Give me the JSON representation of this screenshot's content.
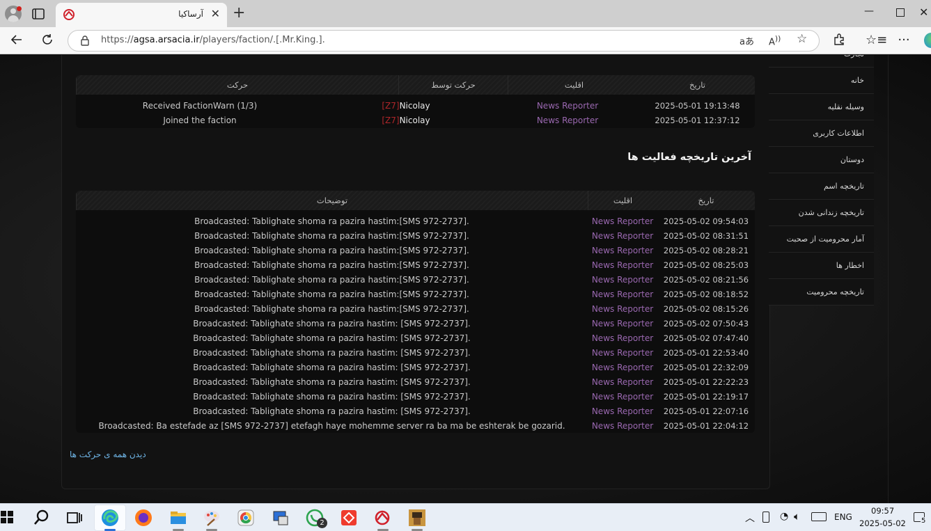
{
  "browser": {
    "tab_title": "آرساکیا",
    "url_prefix": "https://",
    "url_host": "agsa.arsacia.ir",
    "url_path": "/players/faction/.[.Mr.King.]."
  },
  "sidebar": {
    "items": [
      "تجارت",
      "خانه",
      "وسیله نقلیه",
      "اطلاعات کاربری",
      "دوستان",
      "تاریخچه اسم",
      "تاریخچه زندانی شدن",
      "آمار محرومیت از صحبت",
      "اخطار ها",
      "تاریخچه محرومیت"
    ]
  },
  "faction_actions": {
    "headers": {
      "date": "تاریخ",
      "rank": "اقلیت",
      "by": "حرکت توسط",
      "action": "حرکت"
    },
    "rows": [
      {
        "date": "2025-05-01 19:13:48",
        "rank": "News Reporter",
        "by_tag": "[Z7]",
        "by_name": "Nicolay",
        "action": "Received FactionWarn (1/3)"
      },
      {
        "date": "2025-05-01 12:37:12",
        "rank": "News Reporter",
        "by_tag": "[Z7]",
        "by_name": "Nicolay",
        "action": "Joined the faction"
      }
    ]
  },
  "activity": {
    "title": "آخرین تاریخچه فعالیت ها",
    "headers": {
      "date": "تاریخ",
      "rank": "اقلیت",
      "desc": "توضیحات"
    },
    "rows": [
      {
        "date": "2025-05-02 09:54:03",
        "rank": "News Reporter",
        "desc": "Broadcasted: Tablighate shoma ra pazira hastim:[SMS 972-2737]."
      },
      {
        "date": "2025-05-02 08:31:51",
        "rank": "News Reporter",
        "desc": "Broadcasted: Tablighate shoma ra pazira hastim:[SMS 972-2737]."
      },
      {
        "date": "2025-05-02 08:28:21",
        "rank": "News Reporter",
        "desc": "Broadcasted: Tablighate shoma ra pazira hastim:[SMS 972-2737]."
      },
      {
        "date": "2025-05-02 08:25:03",
        "rank": "News Reporter",
        "desc": "Broadcasted: Tablighate shoma ra pazira hastim:[SMS 972-2737]."
      },
      {
        "date": "2025-05-02 08:21:56",
        "rank": "News Reporter",
        "desc": "Broadcasted: Tablighate shoma ra pazira hastim:[SMS 972-2737]."
      },
      {
        "date": "2025-05-02 08:18:52",
        "rank": "News Reporter",
        "desc": "Broadcasted: Tablighate shoma ra pazira hastim:[SMS 972-2737]."
      },
      {
        "date": "2025-05-02 08:15:26",
        "rank": "News Reporter",
        "desc": "Broadcasted: Tablighate shoma ra pazira hastim:[SMS 972-2737]."
      },
      {
        "date": "2025-05-02 07:50:43",
        "rank": "News Reporter",
        "desc": "Broadcasted: Tablighate shoma ra pazira hastim: [SMS 972-2737]."
      },
      {
        "date": "2025-05-02 07:47:40",
        "rank": "News Reporter",
        "desc": "Broadcasted: Tablighate shoma ra pazira hastim: [SMS 972-2737]."
      },
      {
        "date": "2025-05-01 22:53:40",
        "rank": "News Reporter",
        "desc": "Broadcasted: Tablighate shoma ra pazira hastim: [SMS 972-2737]."
      },
      {
        "date": "2025-05-01 22:32:09",
        "rank": "News Reporter",
        "desc": "Broadcasted: Tablighate shoma ra pazira hastim: [SMS 972-2737]."
      },
      {
        "date": "2025-05-01 22:22:23",
        "rank": "News Reporter",
        "desc": "Broadcasted: Tablighate shoma ra pazira hastim: [SMS 972-2737]."
      },
      {
        "date": "2025-05-01 22:19:17",
        "rank": "News Reporter",
        "desc": "Broadcasted: Tablighate shoma ra pazira hastim: [SMS 972-2737]."
      },
      {
        "date": "2025-05-01 22:07:16",
        "rank": "News Reporter",
        "desc": "Broadcasted: Tablighate shoma ra pazira hastim: [SMS 972-2737]."
      },
      {
        "date": "2025-05-01 22:04:12",
        "rank": "News Reporter",
        "desc": "Broadcasted: Ba estefade az [SMS 972-2737] etefagh haye mohemme server ra ba ma be eshterak be gozarid."
      }
    ],
    "view_all": "دیدن همه ی حرکت ها"
  },
  "taskbar": {
    "whatsapp_badge": "2",
    "lang": "ENG",
    "time": "09:57",
    "date": "2025-05-02",
    "notif_count": "5"
  },
  "colors": {
    "rank": "#9a68b0",
    "tag": "#b0262a",
    "link": "#6fb5e6"
  }
}
